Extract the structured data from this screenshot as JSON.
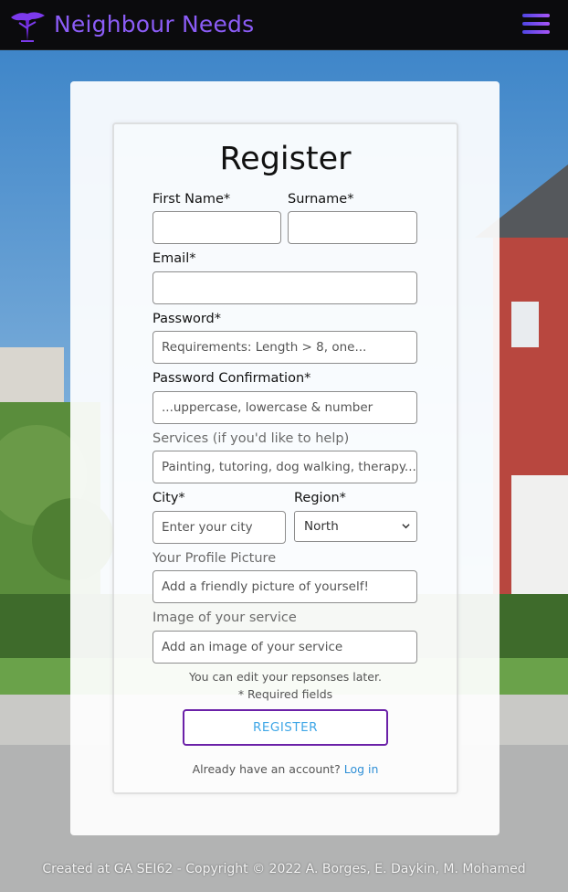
{
  "brand": {
    "name": "Neighbour Needs"
  },
  "colors": {
    "accent": "#8b5cf6",
    "button_border": "#6b21a8",
    "link": "#2f8fd6"
  },
  "form": {
    "title": "Register",
    "first_name_label": "First Name*",
    "surname_label": "Surname*",
    "email_label": "Email*",
    "password_label": "Password*",
    "password_placeholder": "Requirements: Length > 8, one...",
    "password_confirmation_label": "Password Confirmation*",
    "password_confirmation_placeholder": "...uppercase, lowercase & number",
    "services_label": "Services (if you'd like to help)",
    "services_placeholder": "Painting, tutoring, dog walking, therapy...",
    "city_label": "City*",
    "city_placeholder": "Enter your city",
    "region_label": "Region*",
    "region_selected": "North",
    "profile_picture_label": "Your Profile Picture",
    "profile_picture_placeholder": "Add a friendly picture of yourself!",
    "service_image_label": "Image of your service",
    "service_image_placeholder": "Add an image of your service",
    "note_edit": "You can edit your repsonses later.",
    "note_required": "* Required fields",
    "register_button": "REGISTER",
    "login_prompt": "Already have an account?",
    "login_link": "Log in"
  },
  "footer": {
    "text": "Created at GA SEI62 - Copyright © 2022 A. Borges, E. Daykin, M. Mohamed"
  },
  "icons": {
    "logo": "tree-icon",
    "menu": "hamburger-menu-icon",
    "select": "chevron-down-icon"
  }
}
